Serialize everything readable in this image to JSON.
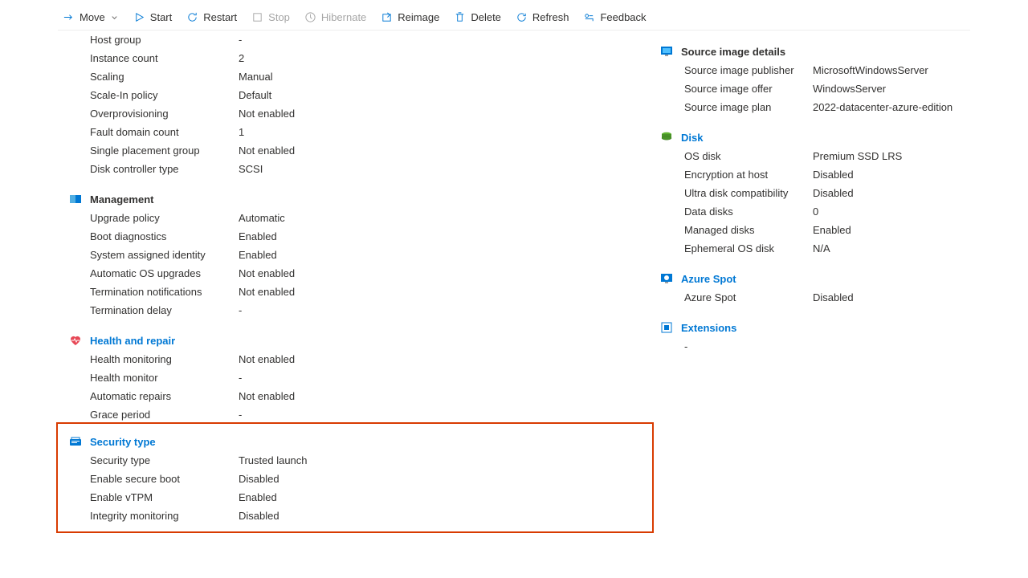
{
  "toolbar": {
    "move": "Move",
    "start": "Start",
    "restart": "Restart",
    "stop": "Stop",
    "hibernate": "Hibernate",
    "reimage": "Reimage",
    "delete": "Delete",
    "refresh": "Refresh",
    "feedback": "Feedback"
  },
  "left": {
    "basic": [
      {
        "k": "Host group",
        "v": "-"
      },
      {
        "k": "Instance count",
        "v": "2"
      },
      {
        "k": "Scaling",
        "v": "Manual"
      },
      {
        "k": "Scale-In policy",
        "v": "Default"
      },
      {
        "k": "Overprovisioning",
        "v": "Not enabled"
      },
      {
        "k": "Fault domain count",
        "v": "1"
      },
      {
        "k": "Single placement group",
        "v": "Not enabled"
      },
      {
        "k": "Disk controller type",
        "v": "SCSI"
      }
    ],
    "management_title": "Management",
    "management": [
      {
        "k": "Upgrade policy",
        "v": "Automatic"
      },
      {
        "k": "Boot diagnostics",
        "v": "Enabled"
      },
      {
        "k": "System assigned identity",
        "v": "Enabled"
      },
      {
        "k": "Automatic OS upgrades",
        "v": "Not enabled"
      },
      {
        "k": "Termination notifications",
        "v": "Not enabled"
      },
      {
        "k": "Termination delay",
        "v": "-"
      }
    ],
    "health_title": "Health and repair",
    "health": [
      {
        "k": "Health monitoring",
        "v": "Not enabled"
      },
      {
        "k": "Health monitor",
        "v": "-"
      },
      {
        "k": "Automatic repairs",
        "v": "Not enabled"
      },
      {
        "k": "Grace period",
        "v": "-"
      }
    ],
    "security_title": "Security type",
    "security": [
      {
        "k": "Security type",
        "v": "Trusted launch"
      },
      {
        "k": "Enable secure boot",
        "v": "Disabled"
      },
      {
        "k": "Enable vTPM",
        "v": "Enabled"
      },
      {
        "k": "Integrity monitoring",
        "v": "Disabled"
      }
    ]
  },
  "right": {
    "source_title": "Source image details",
    "source": [
      {
        "k": "Source image publisher",
        "v": "MicrosoftWindowsServer"
      },
      {
        "k": "Source image offer",
        "v": "WindowsServer"
      },
      {
        "k": "Source image plan",
        "v": "2022-datacenter-azure-edition"
      }
    ],
    "disk_title": "Disk",
    "disk": [
      {
        "k": "OS disk",
        "v": "Premium SSD LRS"
      },
      {
        "k": "Encryption at host",
        "v": "Disabled"
      },
      {
        "k": "Ultra disk compatibility",
        "v": "Disabled"
      },
      {
        "k": "Data disks",
        "v": "0"
      },
      {
        "k": "Managed disks",
        "v": "Enabled"
      },
      {
        "k": "Ephemeral OS disk",
        "v": "N/A"
      }
    ],
    "spot_title": "Azure Spot",
    "spot": [
      {
        "k": "Azure Spot",
        "v": "Disabled"
      }
    ],
    "ext_title": "Extensions",
    "ext_value": "-"
  }
}
